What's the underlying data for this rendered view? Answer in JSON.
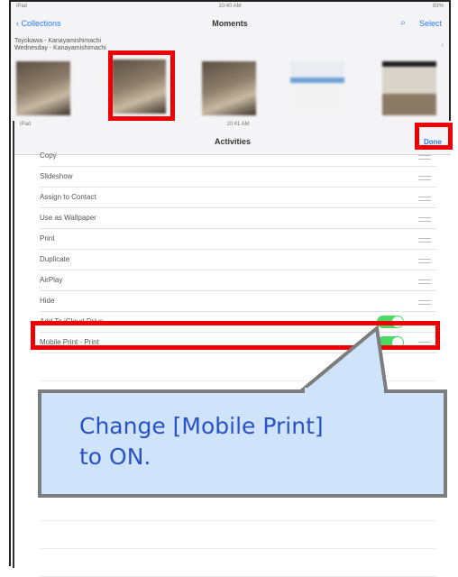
{
  "back_screen": {
    "status_left": "iPad",
    "status_time": "10:40 AM",
    "status_right": "83%",
    "nav_back_label": "Collections",
    "nav_title": "Moments",
    "nav_select_label": "Select",
    "moment_title": "Toyokawa - Kanayamishimachi",
    "moment_subtitle": "Wednesday - Kanayamishimachi"
  },
  "activities": {
    "status_left": "iPad",
    "status_time": "10:41 AM",
    "title": "Activities",
    "done_label": "Done",
    "items": [
      {
        "label": "Copy",
        "toggle": null
      },
      {
        "label": "Slideshow",
        "toggle": null
      },
      {
        "label": "Assign to Contact",
        "toggle": null
      },
      {
        "label": "Use as Wallpaper",
        "toggle": null
      },
      {
        "label": "Print",
        "toggle": null
      },
      {
        "label": "Duplicate",
        "toggle": null
      },
      {
        "label": "AirPlay",
        "toggle": null
      },
      {
        "label": "Hide",
        "toggle": null
      },
      {
        "label": "Add To iCloud Drive",
        "toggle": true
      },
      {
        "label": "Mobile Print - Print",
        "toggle": true
      }
    ]
  },
  "callout": {
    "line1": "Change [Mobile Print]",
    "line2": "to ON."
  },
  "colors": {
    "highlight": "#ee0000",
    "toggle_on": "#4cd964",
    "ios_blue": "#2a7bf6",
    "callout_fill": "#cfe3fb",
    "callout_text": "#2a52c8"
  }
}
